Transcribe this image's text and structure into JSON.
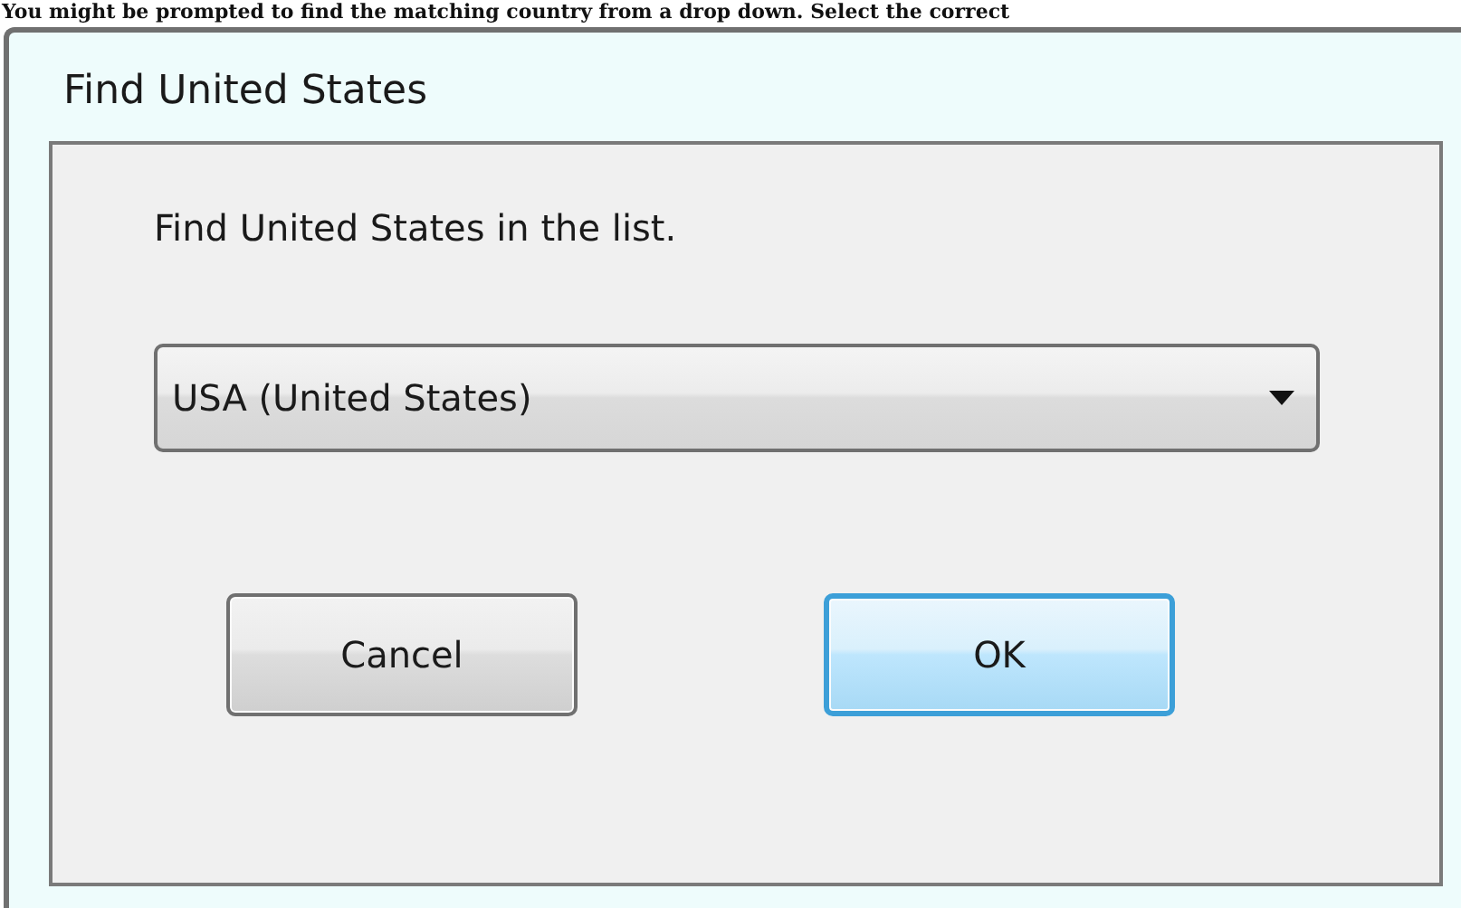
{
  "caption": "You might be prompted to find the matching country from a drop down. Select the correct",
  "window": {
    "title": "Find United States"
  },
  "prompt": "Find United States in the list.",
  "dropdown": {
    "value": "USA (United States)"
  },
  "buttons": [
    {
      "label": "Cancel",
      "default": false
    },
    {
      "label": "OK",
      "default": true
    }
  ]
}
